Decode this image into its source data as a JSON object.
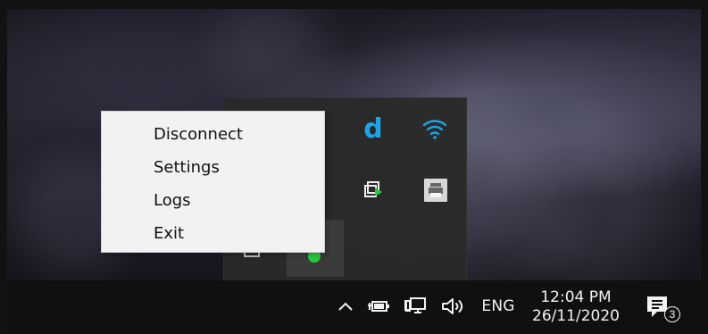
{
  "desktop": {
    "background_name": "dark-rock-wallpaper"
  },
  "context_menu": {
    "items": [
      "Disconnect",
      "Settings",
      "Logs",
      "Exit"
    ]
  },
  "tray_flyout": {
    "icons": [
      "dashlane-icon",
      "wifi-icon",
      "cast-icon",
      "printer-icon",
      "folder-icon",
      "green-status-icon"
    ],
    "dashlane_letter": "d",
    "accent_blue": "#1fa3e7",
    "green_status": "#27c93f"
  },
  "taskbar": {
    "language": "ENG",
    "time": "12:04 PM",
    "date": "26/11/2020",
    "notification_count": "3",
    "icons": [
      "chevron-up-icon",
      "battery-icon",
      "network-icon",
      "volume-icon",
      "notification-icon"
    ]
  }
}
